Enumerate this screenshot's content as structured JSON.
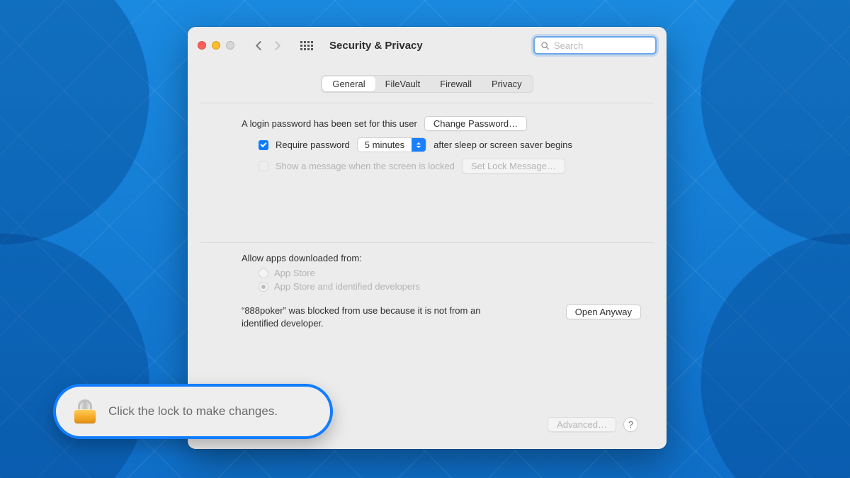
{
  "window": {
    "title": "Security & Privacy"
  },
  "search": {
    "placeholder": "Search"
  },
  "tabs": [
    {
      "label": "General",
      "selected": true
    },
    {
      "label": "FileVault",
      "selected": false
    },
    {
      "label": "Firewall",
      "selected": false
    },
    {
      "label": "Privacy",
      "selected": false
    }
  ],
  "general": {
    "login_password_text": "A login password has been set for this user",
    "change_password_btn": "Change Password…",
    "require_password_label_before": "Require password",
    "require_password_delay": "5 minutes",
    "require_password_label_after": "after sleep or screen saver begins",
    "show_message_label": "Show a message when the screen is locked",
    "set_lock_message_btn": "Set Lock Message…",
    "allow_apps_heading": "Allow apps downloaded from:",
    "radio_app_store": "App Store",
    "radio_identified": "App Store and identified developers",
    "blocked_text": "“888poker” was blocked from use because it is not from an identified developer.",
    "open_anyway_btn": "Open Anyway"
  },
  "footer": {
    "advanced_btn": "Advanced…",
    "help_label": "?"
  },
  "callout": {
    "text": "Click the lock to make changes."
  }
}
